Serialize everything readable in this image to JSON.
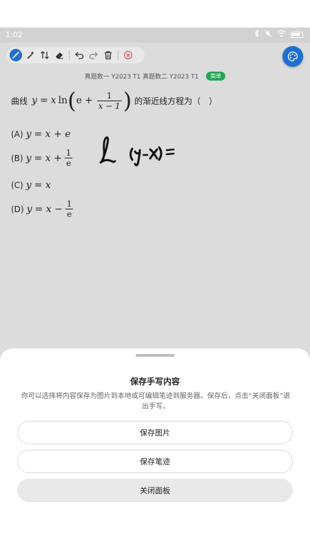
{
  "status": {
    "time": "1:02"
  },
  "source": {
    "text": "真题数一 Y2023 T1 真题数二 Y2023 T1",
    "difficulty": "简单"
  },
  "question": {
    "prefix": "曲线",
    "lhs_var": "y",
    "eq": "=",
    "x": "x",
    "ln": "ln",
    "e": "e",
    "plus": "+",
    "num": "1",
    "den": "x − 1",
    "suffix": "的渐近线方程为（　）"
  },
  "options": [
    {
      "label": "(A)",
      "y": "y",
      "rhs": "= x + e"
    },
    {
      "label": "(B)",
      "y": "y",
      "rhs": "= x +",
      "num": "1",
      "den": "e"
    },
    {
      "label": "(C)",
      "y": "y",
      "rhs": "= x"
    },
    {
      "label": "(D)",
      "y": "y",
      "rhs": "= x −",
      "num": "1",
      "den": "e"
    }
  ],
  "sheet": {
    "title": "保存手写内容",
    "description": "你可以选择将内容保存为图片到本地或可编辑笔迹到服务器。保存后，点击“关闭面板”退出手写。",
    "buttons": {
      "save_image": "保存图片",
      "save_strokes": "保存笔迹",
      "close_panel": "关闭面板"
    }
  },
  "colors": {
    "accent": "#1e6fd0",
    "badge": "#23a455",
    "danger": "#e05555"
  }
}
